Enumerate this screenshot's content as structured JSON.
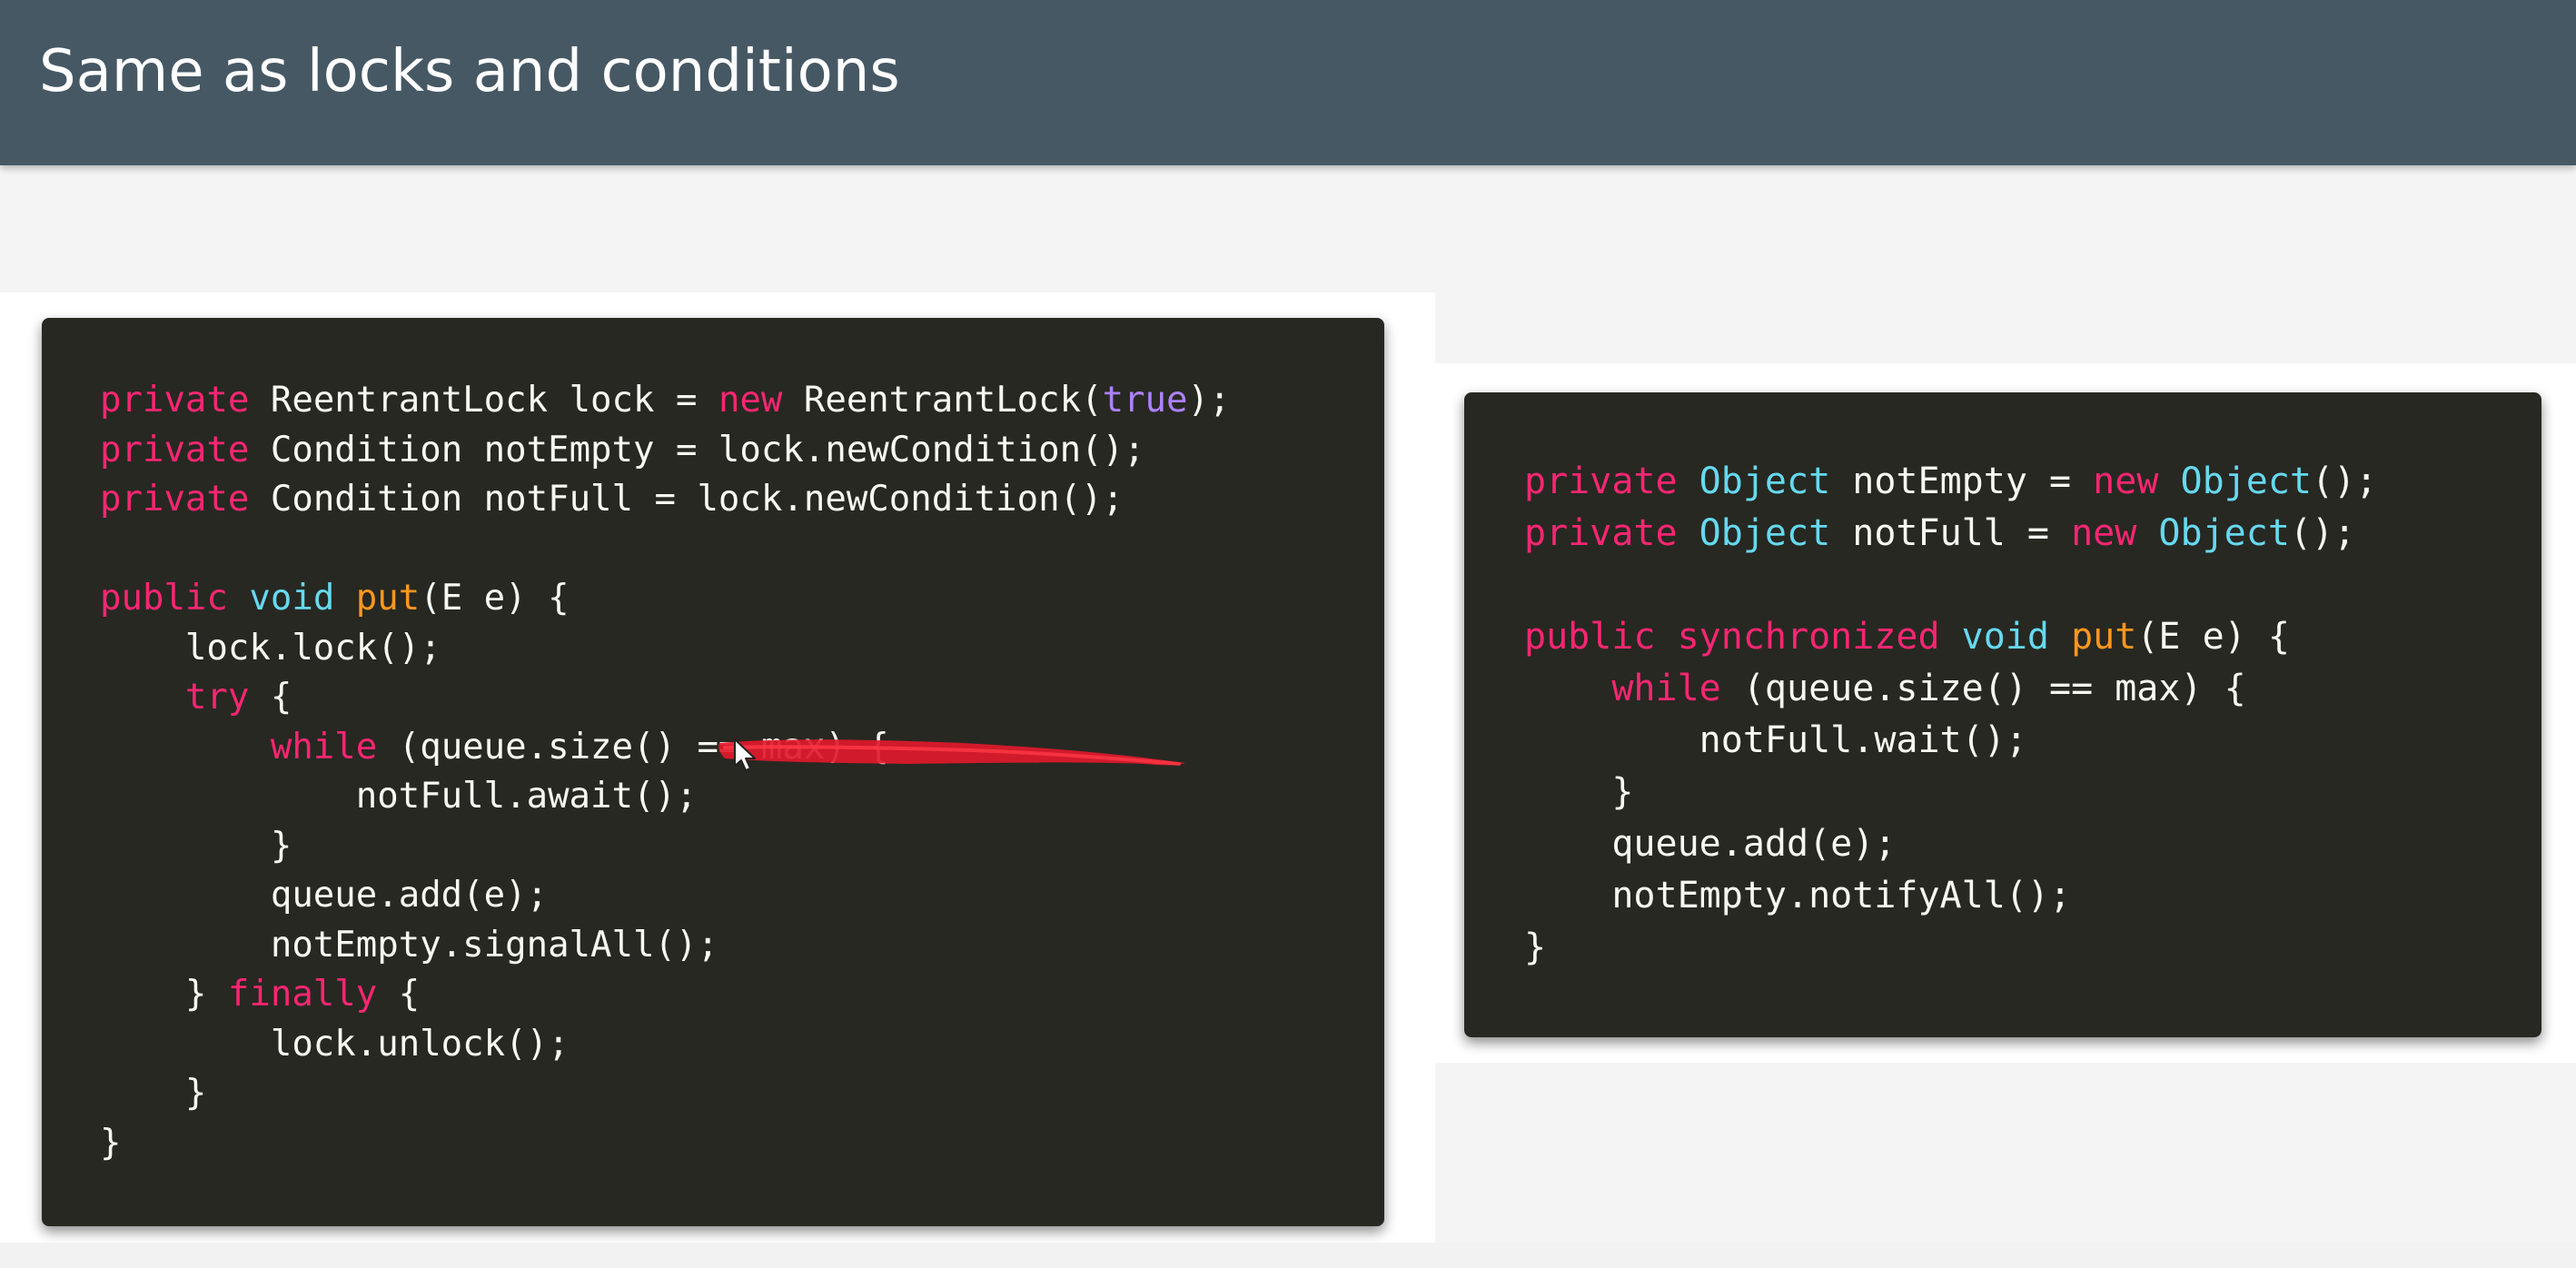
{
  "slide": {
    "title": "Same as locks and conditions"
  },
  "colors": {
    "header": "#465864",
    "code_background": "#272822",
    "keyword": "#f92672",
    "type": "#66d9ef",
    "method": "#fd971f",
    "literal": "#ae81ff",
    "text": "#f8f8f2",
    "annotation": "#e0192b"
  },
  "code_left": {
    "lines": [
      [
        {
          "t": "private",
          "c": "kw"
        },
        {
          "t": " ReentrantLock lock = ",
          "c": "tx"
        },
        {
          "t": "new",
          "c": "kw"
        },
        {
          "t": " ReentrantLock(",
          "c": "tx"
        },
        {
          "t": "true",
          "c": "lit"
        },
        {
          "t": ");",
          "c": "tx"
        }
      ],
      [
        {
          "t": "private",
          "c": "kw"
        },
        {
          "t": " Condition notEmpty = lock.newCondition();",
          "c": "tx"
        }
      ],
      [
        {
          "t": "private",
          "c": "kw"
        },
        {
          "t": " Condition notFull = lock.newCondition();",
          "c": "tx"
        }
      ],
      [],
      [
        {
          "t": "public",
          "c": "kw"
        },
        {
          "t": " ",
          "c": "tx"
        },
        {
          "t": "void",
          "c": "ty"
        },
        {
          "t": " ",
          "c": "tx"
        },
        {
          "t": "put",
          "c": "fn"
        },
        {
          "t": "(E e) {",
          "c": "tx"
        }
      ],
      [
        {
          "t": "    lock.lock();",
          "c": "tx"
        }
      ],
      [
        {
          "t": "    ",
          "c": "tx"
        },
        {
          "t": "try",
          "c": "kw"
        },
        {
          "t": " {",
          "c": "tx"
        }
      ],
      [
        {
          "t": "        ",
          "c": "tx"
        },
        {
          "t": "while",
          "c": "kw"
        },
        {
          "t": " (queue.size() == max) {",
          "c": "tx"
        }
      ],
      [
        {
          "t": "            notFull.await();",
          "c": "tx"
        }
      ],
      [
        {
          "t": "        }",
          "c": "tx"
        }
      ],
      [
        {
          "t": "        queue.add(e);",
          "c": "tx"
        }
      ],
      [
        {
          "t": "        notEmpty.signalAll();",
          "c": "tx"
        }
      ],
      [
        {
          "t": "    } ",
          "c": "tx"
        },
        {
          "t": "finally",
          "c": "kw"
        },
        {
          "t": " {",
          "c": "tx"
        }
      ],
      [
        {
          "t": "        lock.unlock();",
          "c": "tx"
        }
      ],
      [
        {
          "t": "    }",
          "c": "tx"
        }
      ],
      [
        {
          "t": "}",
          "c": "tx"
        }
      ]
    ]
  },
  "code_right": {
    "lines": [
      [
        {
          "t": "private",
          "c": "kw"
        },
        {
          "t": " ",
          "c": "tx"
        },
        {
          "t": "Object",
          "c": "ty"
        },
        {
          "t": " notEmpty = ",
          "c": "tx"
        },
        {
          "t": "new",
          "c": "kw"
        },
        {
          "t": " ",
          "c": "tx"
        },
        {
          "t": "Object",
          "c": "ty"
        },
        {
          "t": "();",
          "c": "tx"
        }
      ],
      [
        {
          "t": "private",
          "c": "kw"
        },
        {
          "t": " ",
          "c": "tx"
        },
        {
          "t": "Object",
          "c": "ty"
        },
        {
          "t": " notFull = ",
          "c": "tx"
        },
        {
          "t": "new",
          "c": "kw"
        },
        {
          "t": " ",
          "c": "tx"
        },
        {
          "t": "Object",
          "c": "ty"
        },
        {
          "t": "();",
          "c": "tx"
        }
      ],
      [],
      [
        {
          "t": "public",
          "c": "kw"
        },
        {
          "t": " ",
          "c": "tx"
        },
        {
          "t": "synchronized",
          "c": "kw"
        },
        {
          "t": " ",
          "c": "tx"
        },
        {
          "t": "void",
          "c": "ty"
        },
        {
          "t": " ",
          "c": "tx"
        },
        {
          "t": "put",
          "c": "fn"
        },
        {
          "t": "(E e) {",
          "c": "tx"
        }
      ],
      [
        {
          "t": "    ",
          "c": "tx"
        },
        {
          "t": "while",
          "c": "kw"
        },
        {
          "t": " (queue.size() == max) {",
          "c": "tx"
        }
      ],
      [
        {
          "t": "        notFull.wait();",
          "c": "tx"
        }
      ],
      [
        {
          "t": "    }",
          "c": "tx"
        }
      ],
      [
        {
          "t": "    queue.add(e);",
          "c": "tx"
        }
      ],
      [
        {
          "t": "    notEmpty.notifyAll();",
          "c": "tx"
        }
      ],
      [
        {
          "t": "}",
          "c": "tx"
        }
      ]
    ]
  }
}
